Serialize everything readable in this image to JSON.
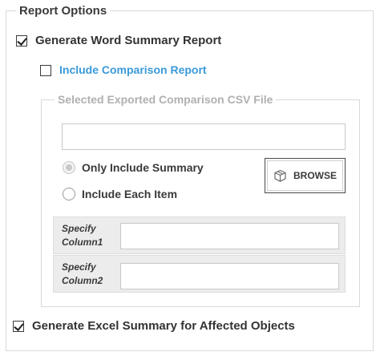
{
  "report_options": {
    "title": "Report Options",
    "generate_word": {
      "label": "Generate Word Summary Report",
      "checked": true
    },
    "include_comparison": {
      "label": "Include Comparison Report",
      "checked": false,
      "color": "#3a9ad9"
    },
    "csv_group": {
      "title": "Selected Exported Comparison CSV File",
      "file_path": {
        "value": "",
        "placeholder": ""
      },
      "radio_options": [
        {
          "label": "Only Include Summary",
          "selected": true
        },
        {
          "label": "Include Each Item",
          "selected": false
        }
      ],
      "browse": {
        "label": "BROWSE",
        "icon": "box-icon"
      },
      "columns": [
        {
          "label": "Specify\nColumn1",
          "value": ""
        },
        {
          "label": "Specify\nColumn2",
          "value": ""
        }
      ]
    },
    "generate_excel": {
      "label": "Generate Excel Summary for Affected Objects",
      "checked": true
    }
  }
}
